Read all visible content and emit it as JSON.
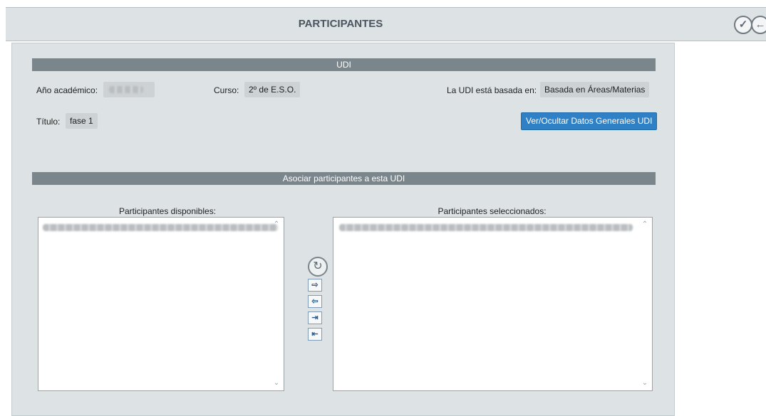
{
  "header": {
    "title": "PARTICIPANTES",
    "confirm_icon": "check-circle-icon",
    "back_icon": "back-arrow-circle-icon"
  },
  "udi_section": {
    "title": "UDI",
    "anio_label": "Año académico:",
    "curso_label": "Curso:",
    "curso_value": "2º de E.S.O.",
    "basada_label": "La UDI está basada en:",
    "basada_value": "Basada en Áreas/Materias",
    "titulo_label": "Título:",
    "titulo_value": "fase 1",
    "toggle_button": "Ver/Ocultar Datos Generales UDI"
  },
  "participants_section": {
    "title": "Asociar participantes a esta UDI",
    "available_label": "Participantes disponibles:",
    "selected_label": "Participantes seleccionados:",
    "controls": [
      "refresh-icon",
      "move-right-icon",
      "move-left-icon",
      "move-all-right-icon",
      "move-all-left-icon"
    ]
  }
}
